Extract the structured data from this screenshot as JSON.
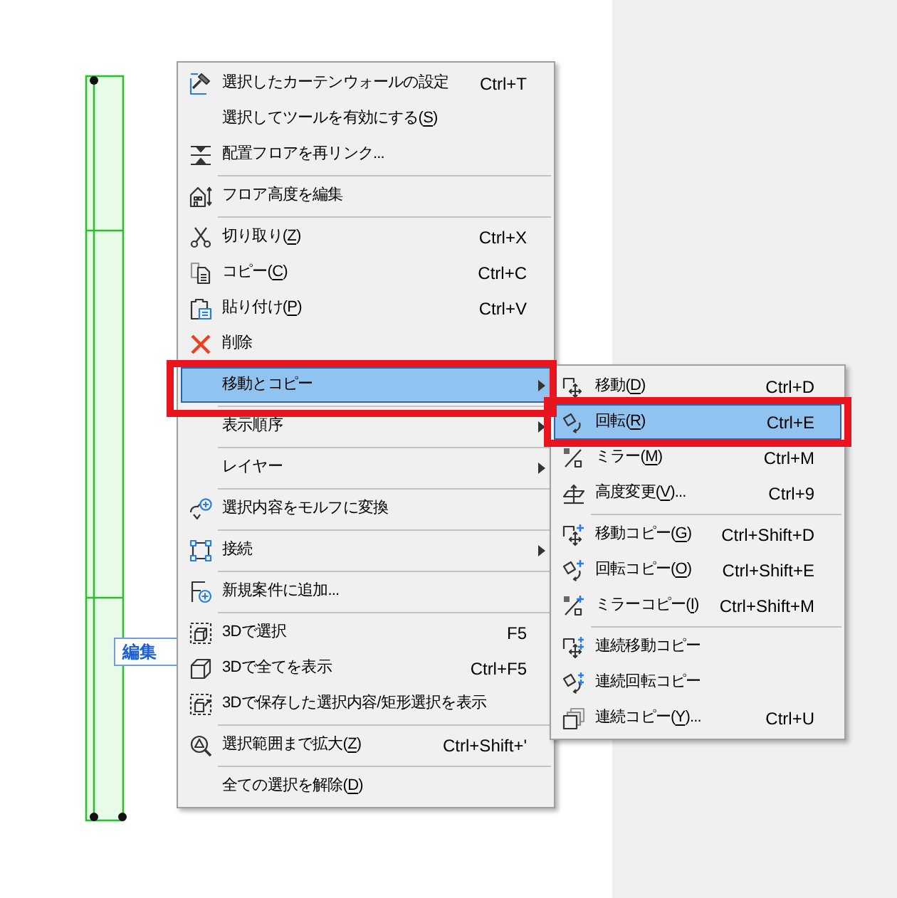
{
  "canvas": {
    "tag_label": "編集"
  },
  "context_menu": {
    "items": [
      {
        "kind": "item",
        "label": "選択したカーテンウォールの設定",
        "shortcut": "Ctrl+T",
        "has_submenu": false,
        "selected": false,
        "outlined": false
      },
      {
        "kind": "item",
        "label": "選択してツールを有効にする(S)",
        "has_submenu": false,
        "selected": false,
        "outlined": false
      },
      {
        "kind": "item",
        "label": "配置フロアを再リンク...",
        "has_submenu": false,
        "selected": false,
        "outlined": false
      },
      {
        "kind": "separator"
      },
      {
        "kind": "item",
        "label": "フロア高度を編集",
        "has_submenu": false,
        "selected": false,
        "outlined": false
      },
      {
        "kind": "separator"
      },
      {
        "kind": "item",
        "label": "切り取り(Z)",
        "shortcut": "Ctrl+X",
        "has_submenu": false,
        "selected": false,
        "outlined": false
      },
      {
        "kind": "item",
        "label": "コピー(C)",
        "shortcut": "Ctrl+C",
        "has_submenu": false,
        "selected": false,
        "outlined": false
      },
      {
        "kind": "item",
        "label": "貼り付け(P)",
        "shortcut": "Ctrl+V",
        "has_submenu": false,
        "selected": false,
        "outlined": false
      },
      {
        "kind": "item",
        "label": "削除",
        "has_submenu": false,
        "selected": false,
        "outlined": false
      },
      {
        "kind": "separator"
      },
      {
        "kind": "item",
        "label": "移動とコピー",
        "has_submenu": true,
        "selected": true,
        "outlined": true
      },
      {
        "kind": "separator"
      },
      {
        "kind": "item",
        "label": "表示順序",
        "has_submenu": true,
        "selected": false,
        "outlined": false
      },
      {
        "kind": "separator"
      },
      {
        "kind": "item",
        "label": "レイヤー",
        "has_submenu": true,
        "selected": false,
        "outlined": false
      },
      {
        "kind": "separator"
      },
      {
        "kind": "item",
        "label": "選択内容をモルフに変換",
        "has_submenu": false,
        "selected": false,
        "outlined": false
      },
      {
        "kind": "separator"
      },
      {
        "kind": "item",
        "label": "接続",
        "has_submenu": true,
        "selected": false,
        "outlined": false
      },
      {
        "kind": "separator"
      },
      {
        "kind": "item",
        "label": "新規案件に追加...",
        "has_submenu": false,
        "selected": false,
        "outlined": false
      },
      {
        "kind": "separator"
      },
      {
        "kind": "item",
        "label": "3Dで選択",
        "shortcut": "F5",
        "has_submenu": false,
        "selected": false,
        "outlined": false
      },
      {
        "kind": "item",
        "label": "3Dで全てを表示",
        "shortcut": "Ctrl+F5",
        "has_submenu": false,
        "selected": false,
        "outlined": false
      },
      {
        "kind": "item",
        "label": "3Dで保存した選択内容/矩形選択を表示",
        "has_submenu": false,
        "selected": false,
        "outlined": false
      },
      {
        "kind": "separator"
      },
      {
        "kind": "item",
        "label": "選択範囲まで拡大(Z)",
        "shortcut": "Ctrl+Shift+'",
        "has_submenu": false,
        "selected": false,
        "outlined": false
      },
      {
        "kind": "separator"
      },
      {
        "kind": "item",
        "label": "全ての選択を解除(D)",
        "has_submenu": false,
        "selected": false,
        "outlined": false
      }
    ]
  },
  "submenu": {
    "items": [
      {
        "kind": "item",
        "label": "移動(D)",
        "shortcut": "Ctrl+D",
        "selected": false,
        "outlined": false
      },
      {
        "kind": "item",
        "label": "回転(R)",
        "shortcut": "Ctrl+E",
        "selected": true,
        "outlined": true
      },
      {
        "kind": "item",
        "label": "ミラー(M)",
        "shortcut": "Ctrl+M",
        "selected": false,
        "outlined": false
      },
      {
        "kind": "item",
        "label": "高度変更(V)...",
        "shortcut": "Ctrl+9",
        "selected": false,
        "outlined": false
      },
      {
        "kind": "separator"
      },
      {
        "kind": "item",
        "label": "移動コピー(G)",
        "shortcut": "Ctrl+Shift+D",
        "selected": false,
        "outlined": false
      },
      {
        "kind": "item",
        "label": "回転コピー(O)",
        "shortcut": "Ctrl+Shift+E",
        "selected": false,
        "outlined": false
      },
      {
        "kind": "item",
        "label": "ミラーコピー(I)",
        "shortcut": "Ctrl+Shift+M",
        "selected": false,
        "outlined": false
      },
      {
        "kind": "separator"
      },
      {
        "kind": "item",
        "label": "連続移動コピー",
        "selected": false,
        "outlined": false
      },
      {
        "kind": "item",
        "label": "連続回転コピー",
        "selected": false,
        "outlined": false
      },
      {
        "kind": "item",
        "label": "連続コピー(Y)...",
        "shortcut": "Ctrl+U",
        "selected": false,
        "outlined": false
      }
    ]
  }
}
